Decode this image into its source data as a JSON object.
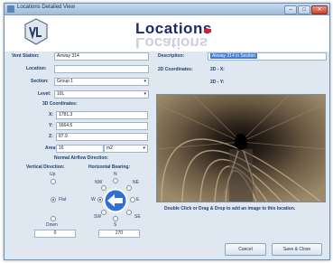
{
  "window": {
    "title": "Locations Detailed View",
    "buttons": {
      "minimize": "–",
      "maximize": "□",
      "close": "✕"
    }
  },
  "header": {
    "title": "Locations"
  },
  "form": {
    "vent_station": {
      "label": "Vent Station:",
      "value": "Airway 314"
    },
    "location": {
      "label": "Location:",
      "value": ""
    },
    "section": {
      "label": "Section:",
      "value": "Group 1"
    },
    "level": {
      "label": "Level:",
      "value": "10L"
    },
    "coords3d": {
      "label": "3D Coordinates:",
      "x": {
        "label": "X:",
        "value": "1781.3"
      },
      "y": {
        "label": "Y:",
        "value": "1664.5"
      },
      "z": {
        "label": "Z:",
        "value": "87.9"
      }
    },
    "area": {
      "label": "Area:",
      "value": "16",
      "unit": "m2"
    },
    "description": {
      "label": "Description:",
      "value": "Airway 314 in Section"
    },
    "coords2d": {
      "label": "2D Coordinates:",
      "zd_x": {
        "label": "2D - X:",
        "value": ""
      },
      "zd_y": {
        "label": "2D - Y:",
        "value": ""
      }
    }
  },
  "airflow": {
    "title": "Normal Airflow Direction:",
    "vertical": {
      "label": "Vertical Direction:",
      "up": "Up",
      "flat": "Flat",
      "down": "Down",
      "selected": "Flat",
      "value": "0"
    },
    "horizontal": {
      "label": "Horizontal Bearing:",
      "n": "N",
      "ne": "NE",
      "e": "E",
      "se": "SE",
      "s": "S",
      "sw": "SW",
      "w": "W",
      "nw": "NW",
      "value": "270"
    }
  },
  "image": {
    "hint": "Double Click or Drag & Drop to add an image to this location."
  },
  "buttons": {
    "cancel": "Cancel",
    "save_close": "Save & Close"
  },
  "colors": {
    "title": "#1d2a6e",
    "accent": "#d8202a",
    "arrow": "#2f6fd6"
  }
}
